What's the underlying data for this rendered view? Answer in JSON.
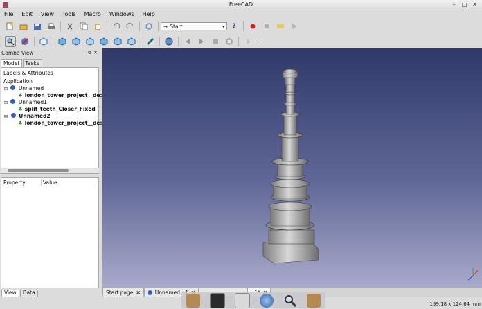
{
  "window": {
    "title": "FreeCAD"
  },
  "menu": [
    "File",
    "Edit",
    "View",
    "Tools",
    "Macro",
    "Windows",
    "Help"
  ],
  "toolbar": {
    "workbench": "Start"
  },
  "combo_view": {
    "title": "Combo View",
    "tabs": [
      "Model",
      "Tasks"
    ],
    "tree_header": "Labels & Attributes",
    "tree_root": "Application",
    "tree": [
      {
        "label": "Unnamed",
        "bold": false
      },
      {
        "label": "london_tower_project__de:",
        "bold": true
      },
      {
        "label": "Unnamed1",
        "bold": false
      },
      {
        "label": "split_teeth_Closer_Fixed",
        "bold": true
      },
      {
        "label": "Unnamed2",
        "bold": true
      },
      {
        "label": "london_tower_project__de:",
        "bold": true
      }
    ],
    "prop_headers": [
      "Property",
      "Value"
    ],
    "bottom_tabs": [
      "View",
      "Data"
    ]
  },
  "doc_tabs": [
    "Start page",
    "Unnamed : 1",
    "",
    ": 1*"
  ],
  "status": {
    "dimensions": "199.18 x 124.64 mm"
  },
  "colors": {
    "accent": "#2f3a6a",
    "record": "#d62020"
  }
}
